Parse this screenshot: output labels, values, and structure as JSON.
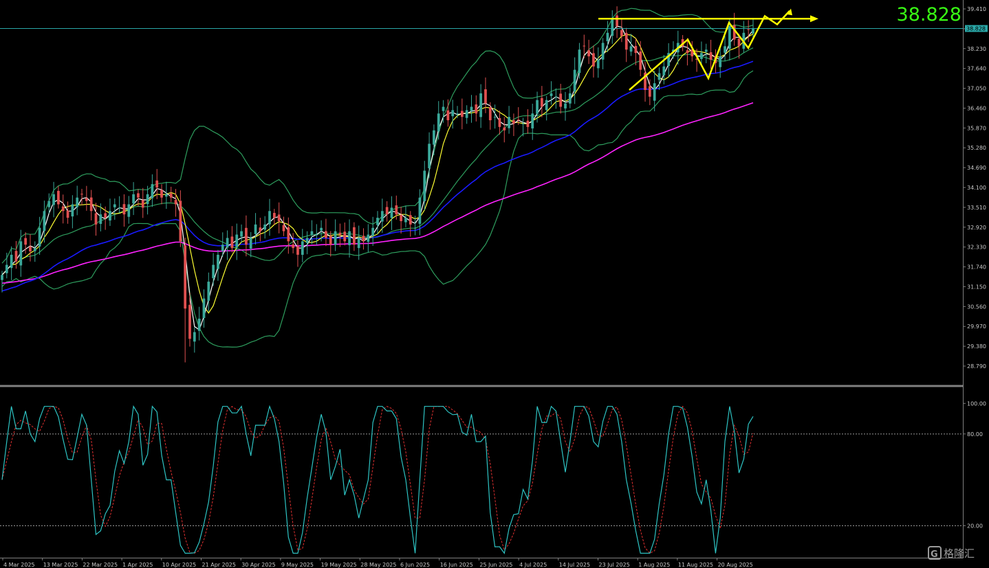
{
  "chart_data": [
    {
      "type": "candlestick",
      "pane": "price",
      "current_price": "38.828",
      "current_price_tag": "38.828",
      "x_labels": [
        "4 Mar 2025",
        "13 Mar 2025",
        "22 Mar 2025",
        "1 Apr 2025",
        "10 Apr 2025",
        "21 Apr 2025",
        "30 Apr 2025",
        "9 May 2025",
        "19 May 2025",
        "28 May 2025",
        "6 Jun 2025",
        "16 Jun 2025",
        "25 Jun 2025",
        "4 Jul 2025",
        "14 Jul 2025",
        "23 Jul 2025",
        "1 Aug 2025",
        "11 Aug 2025",
        "20 Aug 2025"
      ],
      "y_tick_labels": [
        "39.410",
        "38.820",
        "38.230",
        "37.640",
        "37.050",
        "36.460",
        "35.870",
        "35.280",
        "34.690",
        "34.100",
        "33.510",
        "32.920",
        "32.330",
        "31.740",
        "31.150",
        "30.560",
        "29.970",
        "29.380",
        "28.790"
      ],
      "ylim": [
        28.6,
        39.55
      ],
      "close": [
        31.5,
        31.8,
        32.1,
        31.9,
        32.5,
        32.4,
        32.2,
        32.3,
        32.9,
        33.4,
        33.7,
        33.9,
        33.6,
        33.4,
        33.2,
        33.6,
        33.8,
        33.9,
        33.7,
        33.4,
        33.0,
        33.3,
        33.2,
        33.4,
        33.6,
        33.5,
        33.3,
        33.6,
        33.9,
        33.8,
        33.5,
        33.9,
        34.2,
        34.1,
        33.8,
        33.9,
        33.8,
        33.6,
        32.5,
        30.5,
        29.6,
        29.8,
        30.2,
        30.8,
        31.3,
        31.8,
        32.1,
        32.4,
        32.6,
        32.3,
        32.7,
        32.8,
        32.4,
        32.6,
        33.0,
        32.8,
        33.0,
        33.4,
        33.2,
        33.1,
        32.8,
        32.5,
        32.3,
        32.1,
        32.5,
        32.6,
        32.8,
        32.7,
        32.9,
        32.6,
        32.4,
        32.8,
        32.7,
        32.5,
        32.8,
        32.4,
        32.6,
        32.5,
        32.7,
        32.9,
        33.2,
        33.4,
        33.3,
        33.5,
        33.3,
        33.1,
        33.2,
        33.0,
        32.9,
        33.8,
        34.6,
        35.4,
        35.8,
        36.3,
        36.5,
        36.1,
        36.4,
        36.3,
        36.2,
        36.4,
        36.5,
        36.3,
        36.9,
        36.6,
        36.1,
        36.2,
        35.9,
        35.8,
        36.2,
        36.0,
        36.1,
        36.0,
        35.9,
        36.3,
        36.7,
        36.5,
        36.7,
        36.9,
        36.8,
        36.5,
        36.6,
        36.9,
        37.6,
        38.2,
        38.3,
        38.0,
        37.7,
        37.9,
        38.4,
        38.7,
        39.1,
        38.9,
        38.6,
        38.2,
        38.3,
        38.1,
        37.6,
        37.0,
        36.8,
        37.2,
        37.5,
        37.7,
        38.1,
        38.2,
        38.4,
        38.3,
        38.1,
        38.0,
        37.9,
        38.1,
        38.2,
        37.9,
        37.8,
        38.0,
        38.3,
        38.9,
        38.5,
        38.3,
        38.7,
        38.8,
        38.828
      ],
      "overlays": [
        {
          "name": "MA5",
          "color": "#ffffff"
        },
        {
          "name": "MA10",
          "color": "#ffff33"
        },
        {
          "name": "MA50",
          "color": "#1a1aff"
        },
        {
          "name": "MA100",
          "color": "#ff22ff"
        },
        {
          "name": "Bollinger Bands",
          "color": "#2e9e5e"
        }
      ],
      "annotations": [
        {
          "kind": "resistance-line",
          "color": "#ffff00",
          "level": 39.12
        },
        {
          "kind": "zigzag-arrows",
          "color": "#ffff00"
        }
      ],
      "colors": {
        "up": "#3aa89a",
        "down": "#e05050",
        "background": "#000000",
        "price_line": "#2aa8a8"
      }
    },
    {
      "type": "line",
      "pane": "stochastic",
      "ylim": [
        0,
        110
      ],
      "y_tick_labels": [
        "100.00",
        "80.00",
        "20.00"
      ],
      "levels": [
        80,
        20
      ],
      "series": [
        {
          "color": "#2ec4c4",
          "style": "solid"
        },
        {
          "color": "#e03030",
          "style": "dashed"
        }
      ]
    }
  ],
  "watermark": {
    "label": "格隆汇",
    "logo": "G"
  }
}
